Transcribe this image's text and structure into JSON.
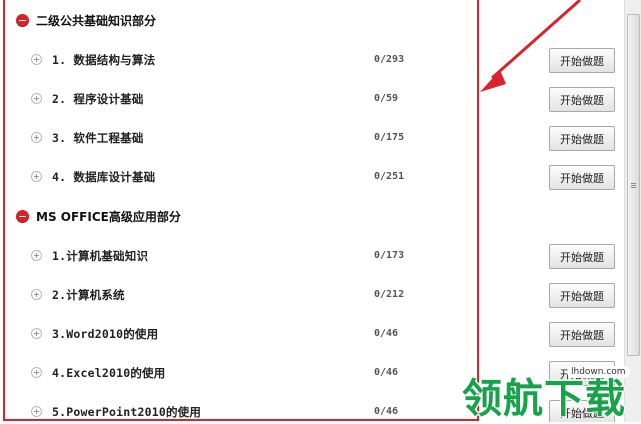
{
  "sections": [
    {
      "title": "二级公共基础知识部分",
      "items": [
        {
          "label": "1. 数据结构与算法",
          "count": "0/293",
          "button": "开始做题"
        },
        {
          "label": "2. 程序设计基础",
          "count": "0/59",
          "button": "开始做题"
        },
        {
          "label": "3. 软件工程基础",
          "count": "0/175",
          "button": "开始做题"
        },
        {
          "label": "4. 数据库设计基础",
          "count": "0/251",
          "button": "开始做题"
        }
      ]
    },
    {
      "title": "MS OFFICE高级应用部分",
      "items": [
        {
          "label": "1.计算机基础知识",
          "count": "0/173",
          "button": "开始做题"
        },
        {
          "label": "2.计算机系统",
          "count": "0/212",
          "button": "开始做题"
        },
        {
          "label": "3.Word2010的使用",
          "count": "0/46",
          "button": "开始做题"
        },
        {
          "label": "4.Excel2010的使用",
          "count": "0/46",
          "button": "开始做题"
        },
        {
          "label": "5.PowerPoint2010的使用",
          "count": "0/46",
          "button": "开始做题"
        }
      ]
    }
  ],
  "watermark": {
    "text": "领航下载",
    "url": "lhdown.com"
  },
  "colors": {
    "accent_red": "#d8242d",
    "watermark_green": "#17a34a"
  },
  "icons": {
    "collapse": "minus-circle-icon",
    "expand": "plus-circle-icon"
  }
}
